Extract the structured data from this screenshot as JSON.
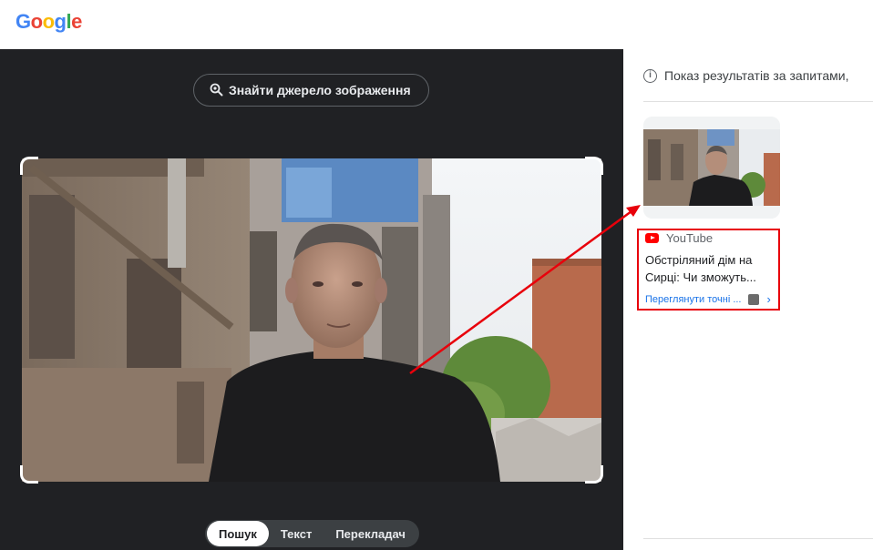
{
  "header": {
    "logo": {
      "letters": [
        "G",
        "o",
        "o",
        "g",
        "l",
        "e"
      ],
      "colors": [
        "#4285F4",
        "#EA4335",
        "#FBBC05",
        "#4285F4",
        "#34A853",
        "#EA4335"
      ]
    }
  },
  "left_pane": {
    "find_source_label": "Знайти джерело зображення",
    "find_source_icon": "lens-search-icon",
    "image_alt": "man-in-black-tshirt-in-front-of-damaged-building",
    "mode_tabs": [
      {
        "label": "Пошук",
        "active": true
      },
      {
        "label": "Текст",
        "active": false
      },
      {
        "label": "Перекладач",
        "active": false
      }
    ]
  },
  "right_pane": {
    "results_info": "Показ результатів за запитами,",
    "result": {
      "source": "YouTube",
      "title": "Обстріляний дім на Сирці: Чи зможуть...",
      "view_exact": "Переглянути точні ..."
    }
  },
  "colors": {
    "dark_bg": "#202124",
    "highlight": "#e8000b",
    "link": "#1a73e8"
  }
}
